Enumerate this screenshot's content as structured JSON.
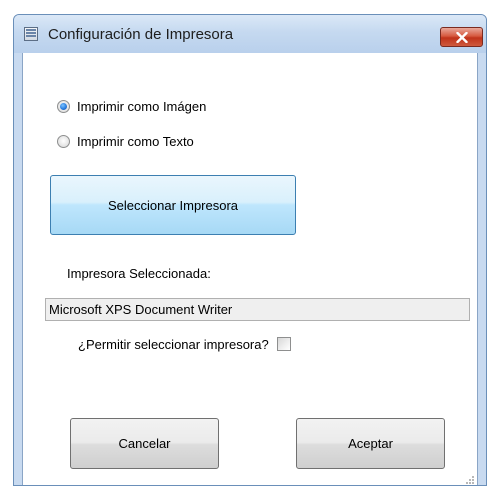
{
  "window": {
    "title": "Configuración de Impresora",
    "icon": "printer-config-app-icon",
    "close_icon": "close-x-icon",
    "accent_color": "#c8daf0",
    "close_color": "#c8391f"
  },
  "print_mode": {
    "options": [
      {
        "label": "Imprimir como Imágen",
        "selected": true
      },
      {
        "label": "Imprimir como Texto",
        "selected": false
      }
    ]
  },
  "select_printer_button": {
    "label": "Seleccionar Impresora"
  },
  "selected_printer": {
    "label": "Impresora Seleccionada:",
    "value": "Microsoft XPS Document Writer"
  },
  "allow_select": {
    "label": "¿Permitir seleccionar impresora?",
    "checked": false
  },
  "footer": {
    "cancel_label": "Cancelar",
    "accept_label": "Aceptar"
  }
}
